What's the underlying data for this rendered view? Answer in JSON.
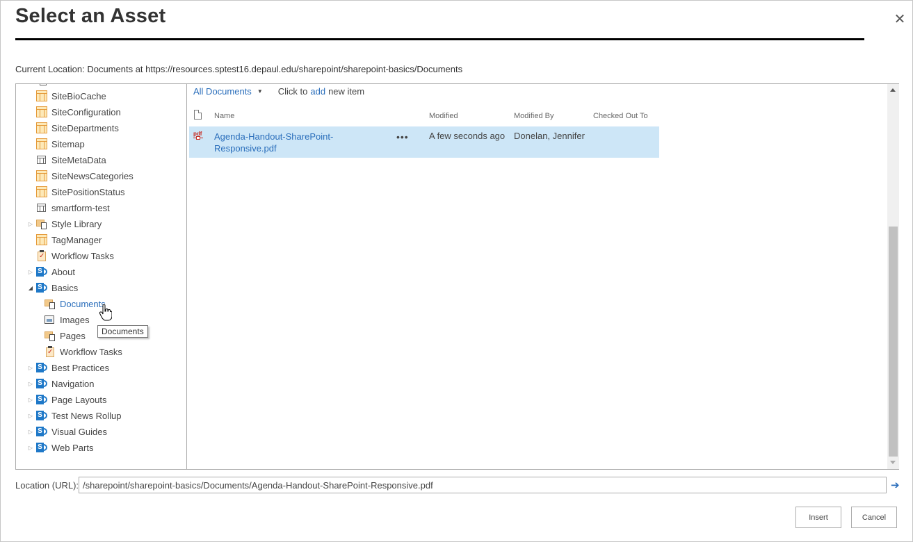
{
  "dialog": {
    "title": "Select an Asset",
    "close_icon": "close-icon"
  },
  "current_location": "Current Location: Documents at https://resources.sptest16.depaul.edu/sharepoint/sharepoint-basics/Documents",
  "tree": {
    "items": [
      {
        "label": "SiteBioCache",
        "icon": "list-orange-icon",
        "level": 0,
        "toggle": "none"
      },
      {
        "label": "SiteConfiguration",
        "icon": "list-orange-icon",
        "level": 0,
        "toggle": "none"
      },
      {
        "label": "SiteDepartments",
        "icon": "list-orange-icon",
        "level": 0,
        "toggle": "none"
      },
      {
        "label": "Sitemap",
        "icon": "list-orange-icon",
        "level": 0,
        "toggle": "none"
      },
      {
        "label": "SiteMetaData",
        "icon": "list-gray-icon",
        "level": 0,
        "toggle": "none"
      },
      {
        "label": "SiteNewsCategories",
        "icon": "list-orange-icon",
        "level": 0,
        "toggle": "none"
      },
      {
        "label": "SitePositionStatus",
        "icon": "list-orange-icon",
        "level": 0,
        "toggle": "none"
      },
      {
        "label": "smartform-test",
        "icon": "list-gray-icon",
        "level": 0,
        "toggle": "none"
      },
      {
        "label": "Style Library",
        "icon": "document-library-icon",
        "level": 0,
        "toggle": "collapsed"
      },
      {
        "label": "TagManager",
        "icon": "list-orange-icon",
        "level": 0,
        "toggle": "none"
      },
      {
        "label": "Workflow Tasks",
        "icon": "tasks-icon",
        "level": 0,
        "toggle": "none"
      },
      {
        "label": "About",
        "icon": "sharepoint-site-icon",
        "level": 0,
        "toggle": "collapsed"
      },
      {
        "label": "Basics",
        "icon": "sharepoint-site-icon",
        "level": 0,
        "toggle": "expanded"
      },
      {
        "label": "Documents",
        "icon": "document-library-icon",
        "level": 1,
        "toggle": "none",
        "selected": true
      },
      {
        "label": "Images",
        "icon": "images-icon",
        "level": 1,
        "toggle": "none"
      },
      {
        "label": "Pages",
        "icon": "document-library-icon",
        "level": 1,
        "toggle": "none"
      },
      {
        "label": "Workflow Tasks",
        "icon": "tasks-icon",
        "level": 1,
        "toggle": "none"
      },
      {
        "label": "Best Practices",
        "icon": "sharepoint-site-icon",
        "level": 0,
        "toggle": "collapsed"
      },
      {
        "label": "Navigation",
        "icon": "sharepoint-site-icon",
        "level": 0,
        "toggle": "collapsed"
      },
      {
        "label": "Page Layouts",
        "icon": "sharepoint-site-icon",
        "level": 0,
        "toggle": "collapsed"
      },
      {
        "label": "Test News Rollup",
        "icon": "sharepoint-site-icon",
        "level": 0,
        "toggle": "collapsed"
      },
      {
        "label": "Visual Guides",
        "icon": "sharepoint-site-icon",
        "level": 0,
        "toggle": "collapsed"
      },
      {
        "label": "Web Parts",
        "icon": "sharepoint-site-icon",
        "level": 0,
        "toggle": "collapsed"
      }
    ],
    "tooltip": "Documents"
  },
  "library": {
    "view_name": "All Documents",
    "add_prefix": "Click to",
    "add_link": "add",
    "add_suffix": "new item",
    "columns": {
      "name": "Name",
      "modified": "Modified",
      "modified_by": "Modified By",
      "checked_out_to": "Checked Out To"
    },
    "rows": [
      {
        "name": "Agenda-Handout-SharePoint-Responsive.pdf",
        "name_line1": "Agenda-Handout-SharePoint-",
        "name_line2": "Responsive.pdf",
        "icon": "pdf-icon",
        "actions": "•••",
        "modified": "A few seconds ago",
        "modified_by": "Donelan, Jennifer",
        "checked_out_to": "",
        "selected": true
      }
    ]
  },
  "location": {
    "label": "Location (URL):",
    "value": "/sharepoint/sharepoint-basics/Documents/Agenda-Handout-SharePoint-Responsive.pdf"
  },
  "buttons": {
    "insert": "Insert",
    "cancel": "Cancel"
  },
  "colors": {
    "accent": "#2a6ebb",
    "selected_row": "#cde6f7",
    "sharepoint_blue": "#1e78c8",
    "list_orange": "#e59a3a"
  }
}
